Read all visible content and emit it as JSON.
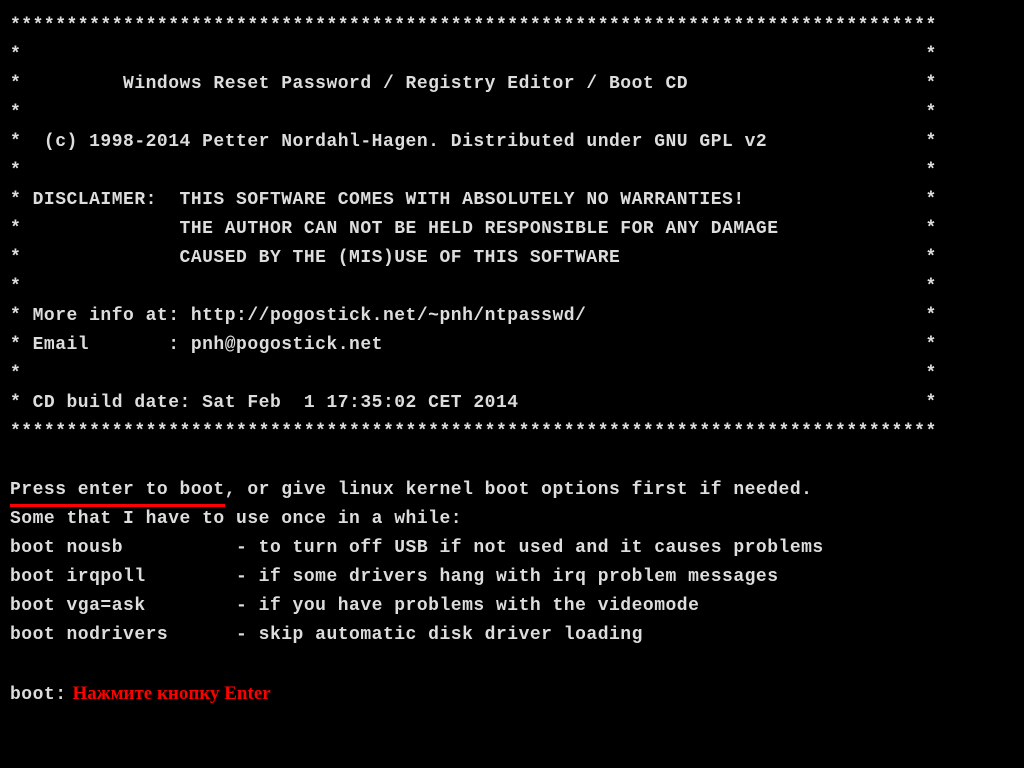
{
  "banner": {
    "border": "**********************************************************************************",
    "blank": "*                                                                                *",
    "title": "*         Windows Reset Password / Registry Editor / Boot CD                     *",
    "copyright": "*  (c) 1998-2014 Petter Nordahl-Hagen. Distributed under GNU GPL v2              *",
    "disclaimer_label": "* DISCLAIMER:  THIS SOFTWARE COMES WITH ABSOLUTELY NO WARRANTIES!                *",
    "disclaimer_l2": "*              THE AUTHOR CAN NOT BE HELD RESPONSIBLE FOR ANY DAMAGE             *",
    "disclaimer_l3": "*              CAUSED BY THE (MIS)USE OF THIS SOFTWARE                           *",
    "more_info": "* More info at: http://pogostick.net/~pnh/ntpasswd/                              *",
    "email": "* Email       : pnh@pogostick.net                                                *",
    "build_date": "* CD build date: Sat Feb  1 17:35:02 CET 2014                                    *",
    "border2": "**********************************************************************************"
  },
  "instructions": {
    "press_enter_highlight": "Press enter to boot",
    "press_enter_rest": ", or give linux kernel boot options first if needed.",
    "intro": "Some that I have to use once in a while:",
    "opt_nousb": "boot nousb          - to turn off USB if not used and it causes problems",
    "opt_irqpoll": "boot irqpoll        - if some drivers hang with irq problem messages",
    "opt_vga": "boot vga=ask        - if you have problems with the videomode",
    "opt_nodrivers": "boot nodrivers      - skip automatic disk driver loading"
  },
  "prompt": {
    "label": "boot:",
    "annotation": "Нажмите кнопку Enter"
  }
}
